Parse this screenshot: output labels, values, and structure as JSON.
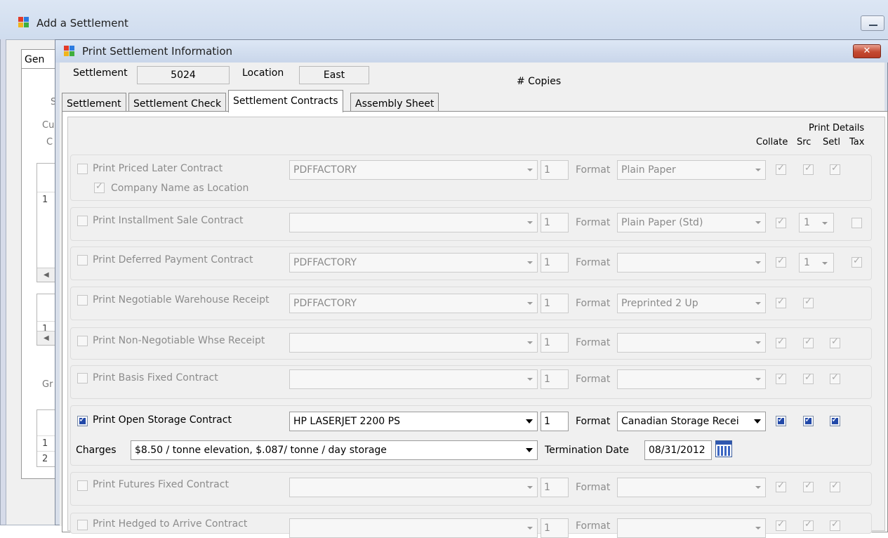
{
  "outer_window": {
    "title": "Add a Settlement",
    "tab_fragment": "Gen",
    "side_fragments": [
      "S",
      "Cu",
      "C",
      "Gr"
    ],
    "grid_rows_a": [
      "1"
    ],
    "grid_rows_b": [
      "1"
    ],
    "grid_rows_c": [
      "1",
      "2"
    ],
    "scroll_left": "◀"
  },
  "dialog": {
    "title": "Print Settlement Information",
    "close_label": "✕",
    "settlement_label": "Settlement",
    "settlement_value": "5024",
    "location_label": "Location",
    "location_value": "East",
    "copies_label": "# Copies"
  },
  "tabs": [
    {
      "label": "Settlement"
    },
    {
      "label": "Settlement Check"
    },
    {
      "label": "Settlement Contracts"
    },
    {
      "label": "Assembly Sheet"
    }
  ],
  "headers": {
    "print_details": "Print Details",
    "collate": "Collate",
    "src": "Src",
    "setl": "Setl",
    "tax": "Tax"
  },
  "rows": [
    {
      "label": "Print Priced Later Contract",
      "printer": "PDFFACTORY",
      "copies": "1",
      "format_label": "Format",
      "format": "Plain Paper",
      "sub_label": "Company Name as Location"
    },
    {
      "label": "Print Installment Sale Contract",
      "printer": "",
      "copies": "1",
      "format_label": "Format",
      "format": "Plain Paper (Std)",
      "setl_value": "1"
    },
    {
      "label": "Print Deferred Payment Contract",
      "printer": "PDFFACTORY",
      "copies": "1",
      "format_label": "Format",
      "format": "",
      "setl_value": "1"
    },
    {
      "label": "Print Negotiable Warehouse Receipt",
      "printer": "PDFFACTORY",
      "copies": "1",
      "format_label": "Format",
      "format": "Preprinted 2 Up"
    },
    {
      "label": "Print Non-Negotiable Whse Receipt",
      "printer": "",
      "copies": "1",
      "format_label": "Format",
      "format": ""
    },
    {
      "label": "Print Basis Fixed Contract",
      "printer": "",
      "copies": "1",
      "format_label": "Format",
      "format": ""
    },
    {
      "label": "Print Open Storage Contract",
      "printer": "HP LASERJET 2200 PS",
      "copies": "1",
      "format_label": "Format",
      "format": "Canadian Storage Recei",
      "charges_label": "Charges",
      "charges": "$8.50 / tonne elevation,  $.087/ tonne / day storage",
      "termination_label": "Termination Date",
      "termination_date": "08/31/2012"
    },
    {
      "label": "Print Futures Fixed Contract",
      "printer": "",
      "copies": "1",
      "format_label": "Format",
      "format": ""
    },
    {
      "label": "Print Hedged to Arrive Contract",
      "printer": "",
      "copies": "1",
      "format_label": "Format",
      "format": ""
    }
  ]
}
